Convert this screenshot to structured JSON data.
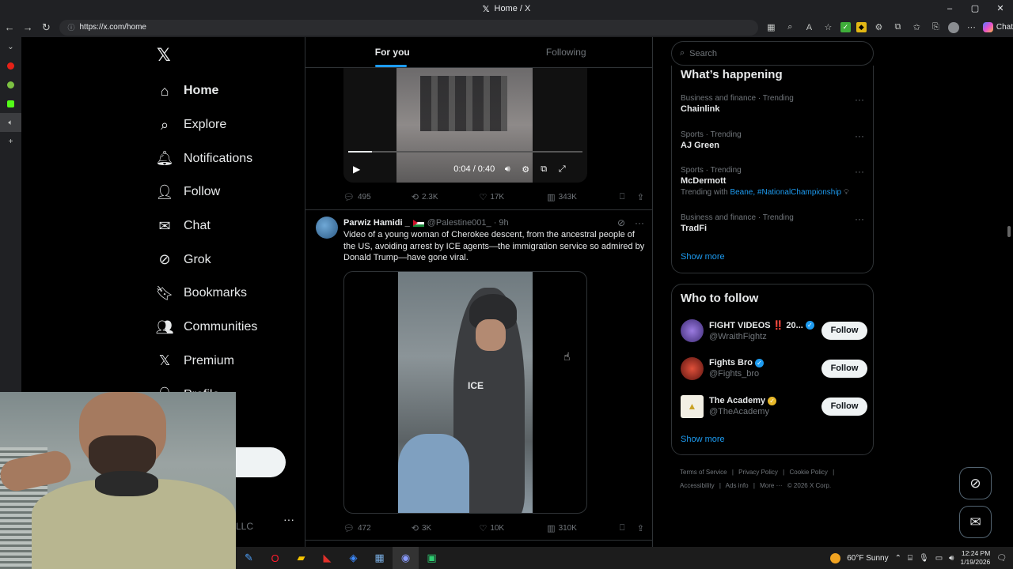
{
  "window": {
    "title": "Home / X",
    "controls": [
      "–",
      "▢",
      "✕"
    ]
  },
  "browser": {
    "url": "https://x.com/home",
    "chat_label": "Chat"
  },
  "nav": {
    "items": [
      {
        "label": "Home",
        "icon": "home-icon",
        "glyph": "⌂"
      },
      {
        "label": "Explore",
        "icon": "search-icon",
        "glyph": "⌕"
      },
      {
        "label": "Notifications",
        "icon": "bell-icon",
        "glyph": "🔔︎"
      },
      {
        "label": "Follow",
        "icon": "add-person-icon",
        "glyph": "👤︎"
      },
      {
        "label": "Chat",
        "icon": "mail-icon",
        "glyph": "✉"
      },
      {
        "label": "Grok",
        "icon": "grok-icon",
        "glyph": "⊘"
      },
      {
        "label": "Bookmarks",
        "icon": "bookmark-icon",
        "glyph": "🔖︎"
      },
      {
        "label": "Communities",
        "icon": "communities-icon",
        "glyph": "👥︎"
      },
      {
        "label": "Premium",
        "icon": "x-logo-icon",
        "glyph": "𝕏"
      },
      {
        "label": "Profile",
        "icon": "person-icon",
        "glyph": "👤︎"
      }
    ],
    "account_fragment": "LLC"
  },
  "tabs": {
    "for_you": "For you",
    "following": "Following"
  },
  "post1": {
    "video_time": "0:04 / 0:40",
    "progress": 0.1,
    "replies": "495",
    "reposts": "2.3K",
    "likes": "17K",
    "views": "343K"
  },
  "post2": {
    "name": "Parwiz Hamidi _",
    "handle": "@Palestine001_ · 9h",
    "text": "Video of a young woman of Cherokee descent, from the ancestral people of the US, avoiding arrest by ICE agents—the immigration service so admired by Donald Trump—have gone viral.",
    "vest_text": "ICE",
    "replies": "472",
    "reposts": "3K",
    "likes": "10K",
    "views": "310K"
  },
  "search": {
    "placeholder": "Search"
  },
  "trending": {
    "title": "What’s happening",
    "items": [
      {
        "category": "Business and finance · Trending",
        "name": "Chainlink"
      },
      {
        "category": "Sports · Trending",
        "name": "AJ Green"
      },
      {
        "category": "Sports · Trending",
        "name": "McDermott",
        "with_prefix": "Trending with",
        "with_tags": "Beane, #NationalChampionship"
      },
      {
        "category": "Business and finance · Trending",
        "name": "TradFi"
      }
    ],
    "show_more": "Show more"
  },
  "who_to_follow": {
    "title": "Who to follow",
    "accounts": [
      {
        "name": "FIGHT VIDEOS ‼️ 20...",
        "handle": "@WraithFightz",
        "badge": "blue",
        "button": "Follow",
        "avatar_color": "#6b4fb8"
      },
      {
        "name": "Fights Bro",
        "handle": "@Fights_bro",
        "badge": "blue",
        "button": "Follow",
        "avatar_color": "#b23a2a"
      },
      {
        "name": "The Academy",
        "handle": "@TheAcademy",
        "badge": "gold",
        "button": "Follow",
        "avatar_color": "#f2efe4"
      }
    ],
    "show_more": "Show more"
  },
  "footer": {
    "line1": [
      "Terms of Service",
      "|",
      "Privacy Policy",
      "|",
      "Cookie Policy",
      "|"
    ],
    "line2": [
      "Accessibility",
      "|",
      "Ads info",
      "|",
      "More ···",
      "© 2026 X Corp."
    ]
  },
  "taskbar": {
    "weather": "60°F  Sunny",
    "time": "12:24 PM",
    "date": "1/19/2026"
  }
}
